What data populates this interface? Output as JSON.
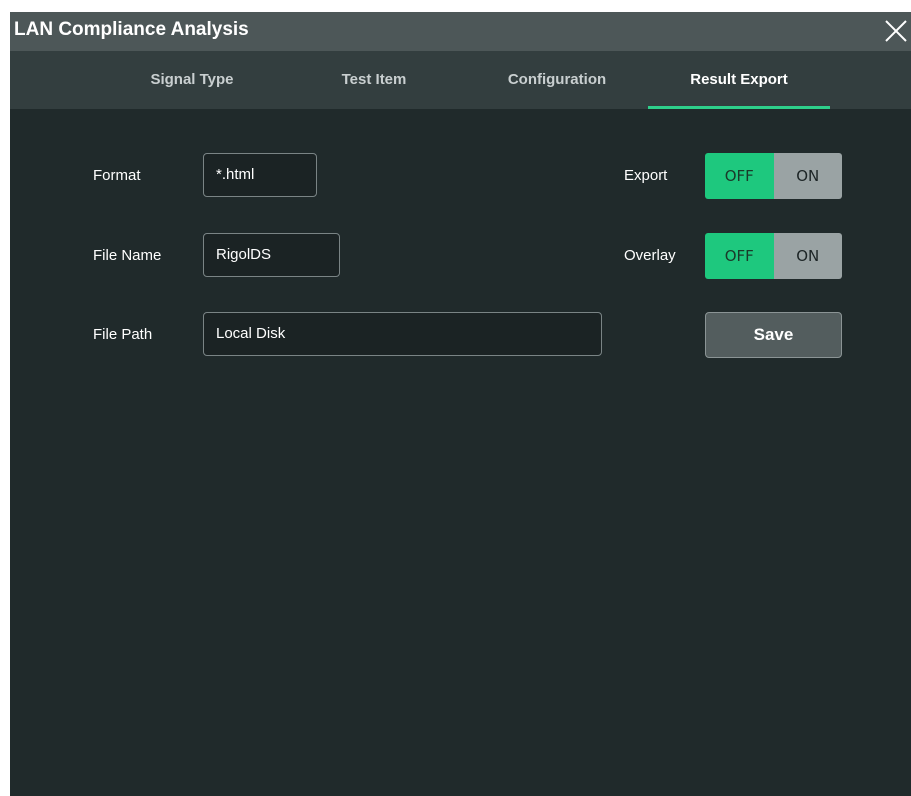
{
  "window": {
    "title": "LAN Compliance Analysis",
    "close_icon": "close-icon"
  },
  "tabs": [
    {
      "label": "Signal Type",
      "active": false
    },
    {
      "label": "Test Item",
      "active": false
    },
    {
      "label": "Configuration",
      "active": false
    },
    {
      "label": "Result Export",
      "active": true
    }
  ],
  "form": {
    "format": {
      "label": "Format",
      "value": "*.html"
    },
    "file_name": {
      "label": "File Name",
      "value": "RigolDS"
    },
    "file_path": {
      "label": "File Path",
      "value": "Local Disk"
    }
  },
  "export": {
    "label": "Export",
    "off_label": "OFF",
    "on_label": "ON",
    "state": "OFF"
  },
  "overlay": {
    "label": "Overlay",
    "off_label": "OFF",
    "on_label": "ON",
    "state": "OFF"
  },
  "save_button": {
    "label": "Save"
  },
  "colors": {
    "accent": "#2ecf8b",
    "toggle_off_active": "#1ec87e",
    "background": "#202a2b",
    "titlebar": "#4d5758"
  }
}
